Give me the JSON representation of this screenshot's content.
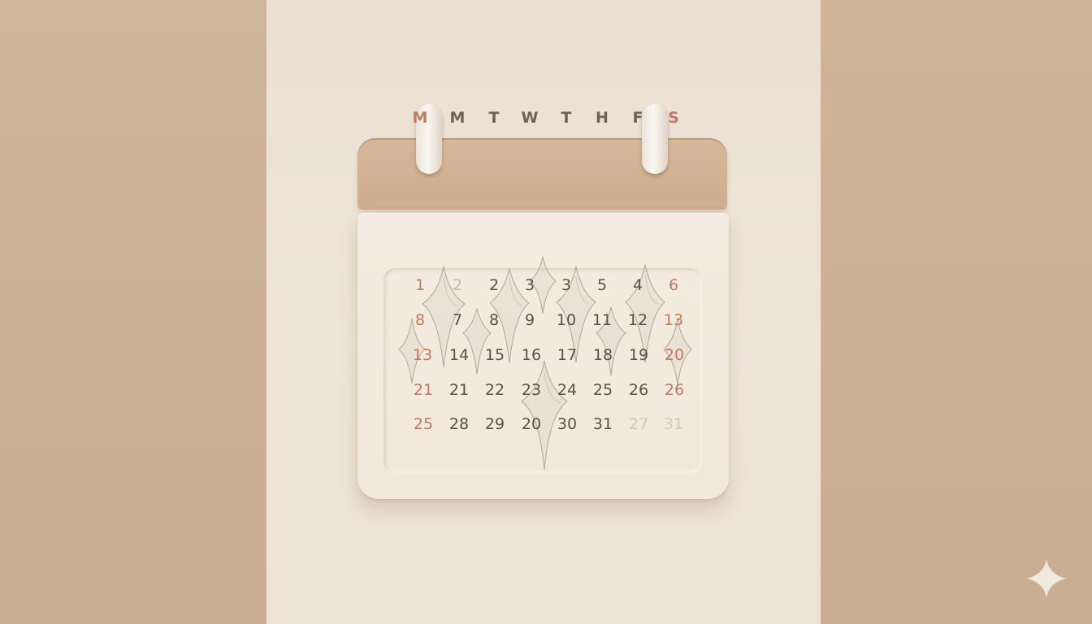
{
  "calendar": {
    "weekdays": [
      "M",
      "M",
      "T",
      "W",
      "T",
      "H",
      "F",
      "S"
    ],
    "rows": [
      [
        "1",
        "2",
        "2",
        "3",
        "3",
        "5",
        "4",
        "6"
      ],
      [
        "8",
        "7",
        "8",
        "9",
        "10",
        "11",
        "12",
        "13"
      ],
      [
        "13",
        "14",
        "15",
        "16",
        "17",
        "18",
        "19",
        "20"
      ],
      [
        "21",
        "21",
        "22",
        "23",
        "24",
        "25",
        "26",
        "26"
      ],
      [
        "25",
        "28",
        "29",
        "20",
        "30",
        "31",
        "27",
        "31"
      ]
    ]
  },
  "colors": {
    "side_panels": "#cdb298",
    "center_panel": "#ece2d5",
    "calendar_header": "#d0b294",
    "calendar_body": "#f3eadd",
    "accent_text": "#c07a5e",
    "day_text": "#5d5045"
  },
  "icons": [
    "binder-ring-icon",
    "sparkle-ornament-icon",
    "four-point-star-icon"
  ]
}
